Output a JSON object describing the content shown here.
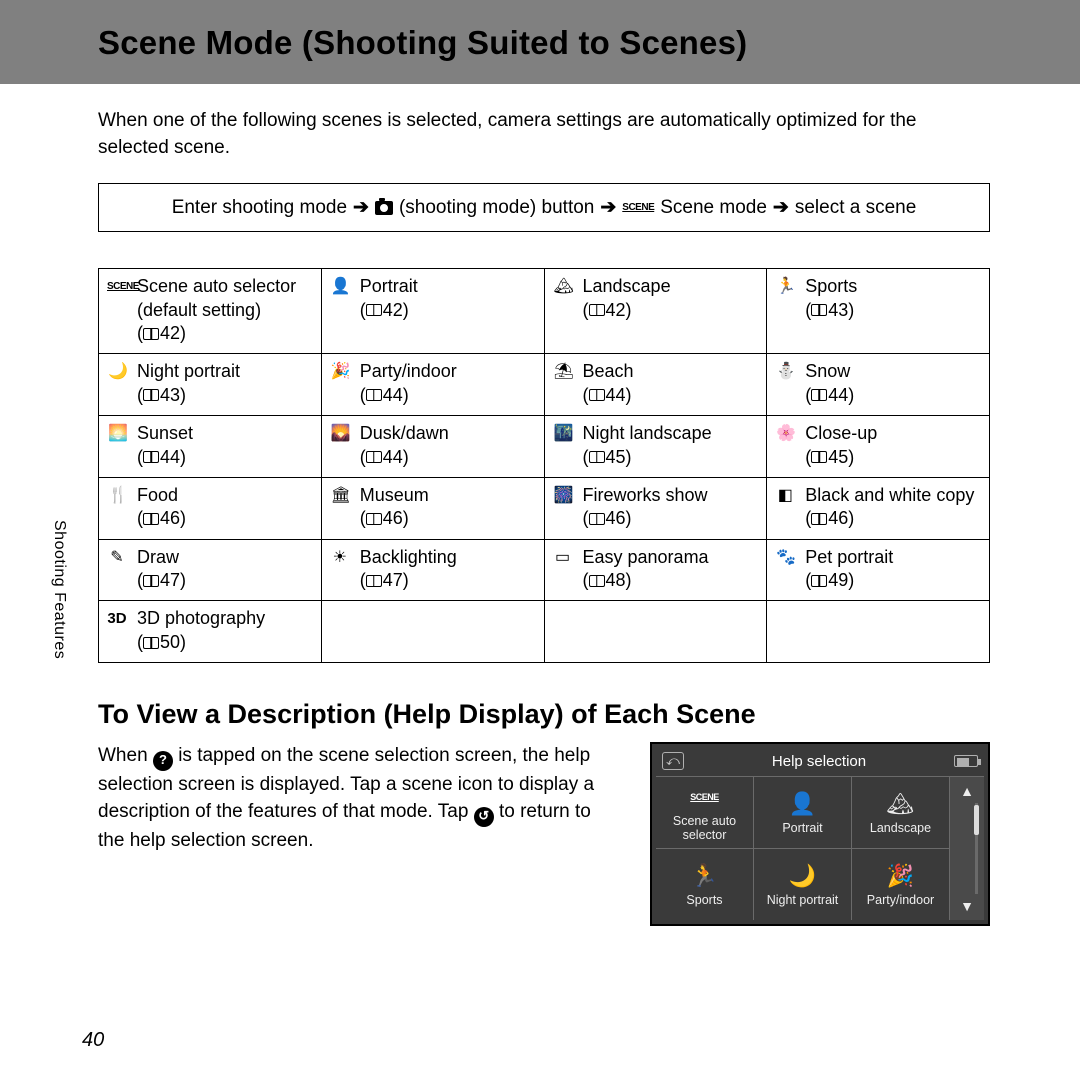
{
  "header": {
    "title": "Scene Mode (Shooting Suited to Scenes)"
  },
  "intro": "When one of the following scenes is selected, camera settings are automatically optimized for the selected scene.",
  "breadcrumb": {
    "p1": "Enter shooting mode",
    "p2": "(shooting mode) button",
    "p3": "Scene mode",
    "p4": "select a scene"
  },
  "scenes": [
    [
      {
        "glyph": "SCENE",
        "name": "Scene auto selector",
        "sub": "(default setting)",
        "page": "42"
      },
      {
        "glyph": "👤",
        "name": "Portrait",
        "page": "42"
      },
      {
        "glyph": "🏔",
        "name": "Landscape",
        "page": "42"
      },
      {
        "glyph": "🏃",
        "name": "Sports",
        "page": "43"
      }
    ],
    [
      {
        "glyph": "🌙",
        "name": "Night portrait",
        "page": "43"
      },
      {
        "glyph": "🎉",
        "name": "Party/indoor",
        "page": "44"
      },
      {
        "glyph": "⛱",
        "name": "Beach",
        "page": "44"
      },
      {
        "glyph": "⛄",
        "name": "Snow",
        "page": "44"
      }
    ],
    [
      {
        "glyph": "🌅",
        "name": "Sunset",
        "page": "44"
      },
      {
        "glyph": "🌄",
        "name": "Dusk/dawn",
        "page": "44"
      },
      {
        "glyph": "🌃",
        "name": "Night landscape",
        "page": "45"
      },
      {
        "glyph": "🌸",
        "name": "Close-up",
        "page": "45"
      }
    ],
    [
      {
        "glyph": "🍴",
        "name": "Food",
        "page": "46"
      },
      {
        "glyph": "🏛",
        "name": "Museum",
        "page": "46"
      },
      {
        "glyph": "🎆",
        "name": "Fireworks show",
        "page": "46"
      },
      {
        "glyph": "◧",
        "name": "Black and white copy",
        "page": "46"
      }
    ],
    [
      {
        "glyph": "✎",
        "name": "Draw",
        "page": "47"
      },
      {
        "glyph": "☀",
        "name": "Backlighting",
        "page": "47"
      },
      {
        "glyph": "▭",
        "name": "Easy panorama",
        "page": "48"
      },
      {
        "glyph": "🐾",
        "name": "Pet portrait",
        "page": "49"
      }
    ],
    [
      {
        "glyph": "3D",
        "name": "3D photography",
        "page": "50"
      }
    ]
  ],
  "help_section": {
    "heading": "To View a Description (Help Display) of Each Scene",
    "para_a": "When ",
    "para_b": " is tapped on the scene selection screen, the help selection screen is displayed. Tap a scene icon to display a description of the features of that mode. Tap ",
    "para_c": " to return to the help selection screen."
  },
  "lcd": {
    "title": "Help selection",
    "cells": [
      {
        "glyph": "SCENE",
        "label": "Scene auto selector"
      },
      {
        "glyph": "👤",
        "label": "Portrait"
      },
      {
        "glyph": "🏔",
        "label": "Landscape"
      },
      {
        "glyph": "🏃",
        "label": "Sports"
      },
      {
        "glyph": "🌙",
        "label": "Night portrait"
      },
      {
        "glyph": "🎉",
        "label": "Party/indoor"
      }
    ]
  },
  "sidebar_label": "Shooting Features",
  "page_number": "40"
}
